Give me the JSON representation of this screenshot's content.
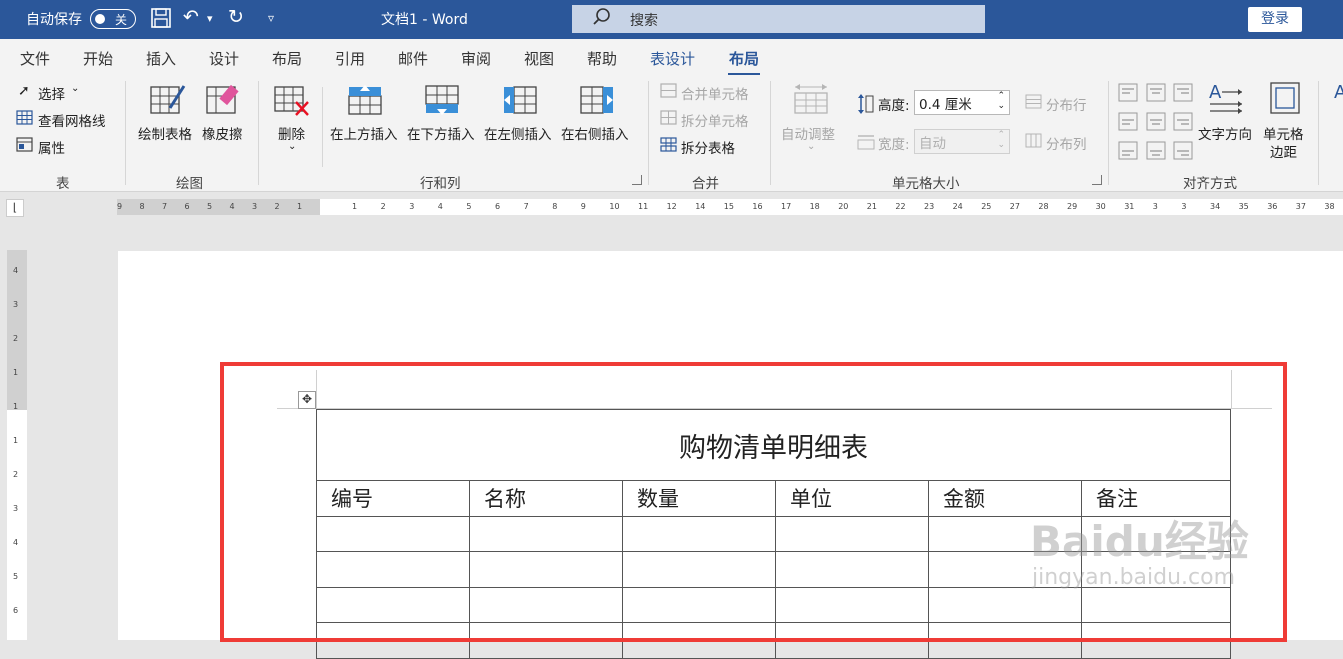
{
  "titlebar": {
    "autosave_label": "自动保存",
    "autosave_state": "关",
    "doc_title": "文档1  -  Word",
    "search_placeholder": "搜索",
    "login_label": "登录"
  },
  "tabs": [
    "文件",
    "开始",
    "插入",
    "设计",
    "布局",
    "引用",
    "邮件",
    "审阅",
    "视图",
    "帮助",
    "表设计",
    "布局"
  ],
  "ribbon": {
    "table_group": {
      "select": "选择",
      "view_gridlines": "查看网格线",
      "properties": "属性",
      "label": "表"
    },
    "draw_group": {
      "draw_table": "绘制表格",
      "eraser": "橡皮擦",
      "label": "绘图"
    },
    "rows_cols_group": {
      "delete": "删除",
      "insert_above": "在上方插入",
      "insert_below": "在下方插入",
      "insert_left": "在左侧插入",
      "insert_right": "在右侧插入",
      "label": "行和列"
    },
    "merge_group": {
      "merge_cells": "合并单元格",
      "split_cells": "拆分单元格",
      "split_table": "拆分表格",
      "label": "合并"
    },
    "cell_size_group": {
      "autofit": "自动调整",
      "height_label": "高度:",
      "height_value": "0.4 厘米",
      "width_label": "宽度:",
      "width_value": "自动",
      "distribute_rows": "分布行",
      "distribute_cols": "分布列",
      "label": "单元格大小"
    },
    "align_group": {
      "text_direction": "文字方向",
      "cell_margins_1": "单元格",
      "cell_margins_2": "边距",
      "label": "对齐方式"
    }
  },
  "ruler": {
    "h_left": [
      "9",
      "8",
      "7",
      "6",
      "5",
      "4",
      "3",
      "2",
      "1"
    ],
    "h_right": [
      "1",
      "2",
      "3",
      "4",
      "5",
      "6",
      "7",
      "8",
      "9",
      "10",
      "11",
      "12",
      "14",
      "15",
      "16",
      "17",
      "18",
      "20",
      "21",
      "22",
      "23",
      "24",
      "25",
      "27",
      "28",
      "29",
      "30",
      "31",
      "3",
      "3",
      "34",
      "35",
      "36",
      "37",
      "38",
      "40",
      "41",
      "42",
      "43"
    ],
    "v": [
      "4",
      "3",
      "2",
      "1",
      "1",
      "1",
      "2",
      "3",
      "4",
      "5",
      "6"
    ]
  },
  "document": {
    "table_title": "购物清单明细表",
    "headers": [
      "编号",
      "名称",
      "数量",
      "单位",
      "金额",
      "备注"
    ],
    "empty_rows": 4
  },
  "watermark": {
    "line1": "Baidu经验",
    "line2": "jingyan.baidu.com"
  },
  "colors": {
    "title_bar": "#2b579a",
    "highlight_box": "#ef3b36"
  }
}
